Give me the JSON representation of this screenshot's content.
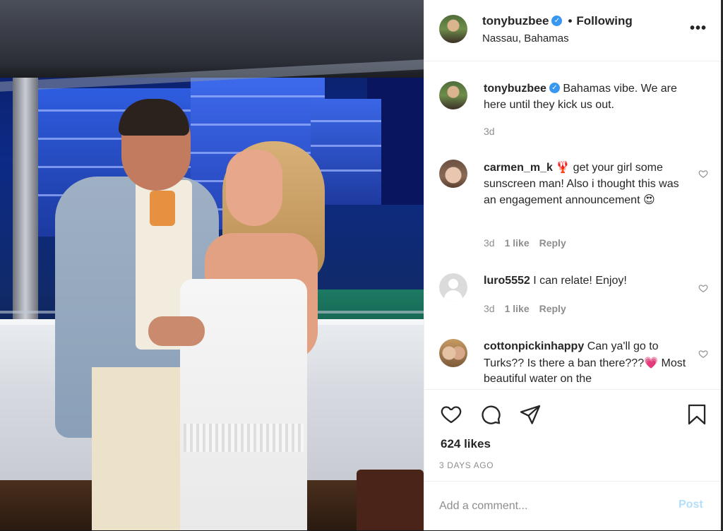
{
  "post": {
    "username": "tonybuzbee",
    "follow_status": "Following",
    "separator": "•",
    "location": "Nassau, Bahamas",
    "more_label": "•••"
  },
  "comments": [
    {
      "username": "tonybuzbee",
      "text": "Bahamas vibe. We are here until they kick us out.",
      "time": "3d",
      "verified": true,
      "is_caption": true
    },
    {
      "username": "carmen_m_k",
      "text_before": "get your girl some sunscreen man! Also i thought this was an engagement announcement",
      "lead_emoji": "🦞",
      "trail_emoji": "😍",
      "time": "3d",
      "likes": "1 like",
      "reply": "Reply"
    },
    {
      "username": "luro5552",
      "text": "I can relate! Enjoy!",
      "time": "3d",
      "likes": "1 like",
      "reply": "Reply"
    },
    {
      "username": "cottonpickinhappy",
      "text": "Can ya'll go to Turks?? Is there a ban there???",
      "trail_emoji": "💗",
      "text_after": "Most beautiful water on the"
    }
  ],
  "stats": {
    "likes": "624 likes",
    "posted": "3 DAYS AGO"
  },
  "composer": {
    "placeholder": "Add a comment...",
    "post_label": "Post"
  },
  "icons": {
    "verified": "verified-badge-icon",
    "like": "heart-icon",
    "comment": "comment-bubble-icon",
    "share": "paper-plane-icon",
    "save": "bookmark-icon",
    "more": "more-options-icon"
  },
  "colors": {
    "verified_blue": "#3897f0",
    "muted_text": "#8e8e8e",
    "post_disabled": "#b2dffc"
  }
}
